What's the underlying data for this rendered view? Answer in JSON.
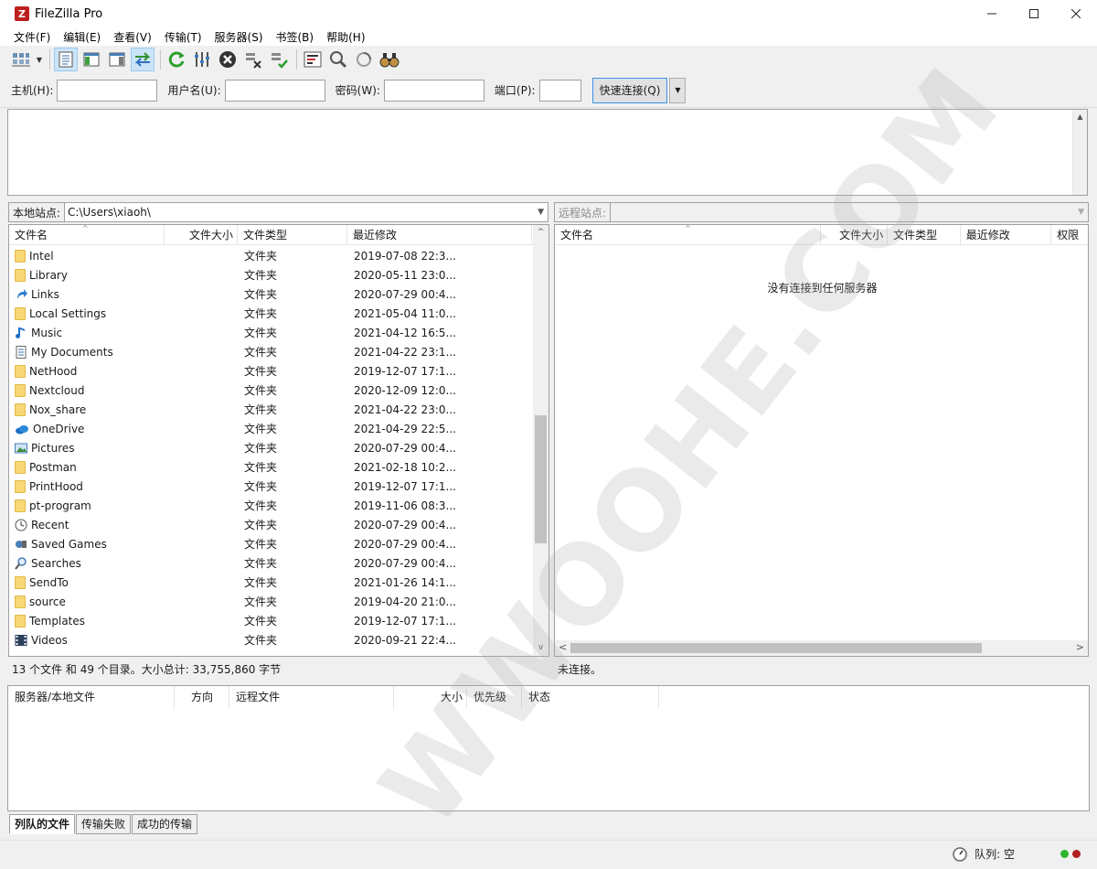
{
  "window": {
    "title": "FileZilla Pro",
    "app_icon": "Z"
  },
  "menu": [
    "文件(F)",
    "编辑(E)",
    "查看(V)",
    "传输(T)",
    "服务器(S)",
    "书签(B)",
    "帮助(H)"
  ],
  "quickconnect": {
    "host_label": "主机(H):",
    "host_value": "",
    "user_label": "用户名(U):",
    "user_value": "",
    "pass_label": "密码(W):",
    "pass_value": "",
    "port_label": "端口(P):",
    "port_value": "",
    "connect_label": "快速连接(Q)"
  },
  "local": {
    "site_label": "本地站点:",
    "path": "C:\\Users\\xiaoh\\",
    "columns": [
      "文件名",
      "文件大小",
      "文件类型",
      "最近修改"
    ],
    "rows": [
      {
        "name": "Intel",
        "type": "文件夹",
        "modified": "2019-07-08 22:3...",
        "icon": "folder"
      },
      {
        "name": "Library",
        "type": "文件夹",
        "modified": "2020-05-11 23:0...",
        "icon": "folder"
      },
      {
        "name": "Links",
        "type": "文件夹",
        "modified": "2020-07-29 00:4...",
        "icon": "link"
      },
      {
        "name": "Local Settings",
        "type": "文件夹",
        "modified": "2021-05-04 11:0...",
        "icon": "folder"
      },
      {
        "name": "Music",
        "type": "文件夹",
        "modified": "2021-04-12 16:5...",
        "icon": "music"
      },
      {
        "name": "My Documents",
        "type": "文件夹",
        "modified": "2021-04-22 23:1...",
        "icon": "document"
      },
      {
        "name": "NetHood",
        "type": "文件夹",
        "modified": "2019-12-07 17:1...",
        "icon": "folder"
      },
      {
        "name": "Nextcloud",
        "type": "文件夹",
        "modified": "2020-12-09 12:0...",
        "icon": "folder"
      },
      {
        "name": "Nox_share",
        "type": "文件夹",
        "modified": "2021-04-22 23:0...",
        "icon": "folder"
      },
      {
        "name": "OneDrive",
        "type": "文件夹",
        "modified": "2021-04-29 22:5...",
        "icon": "cloud"
      },
      {
        "name": "Pictures",
        "type": "文件夹",
        "modified": "2020-07-29 00:4...",
        "icon": "picture"
      },
      {
        "name": "Postman",
        "type": "文件夹",
        "modified": "2021-02-18 10:2...",
        "icon": "folder"
      },
      {
        "name": "PrintHood",
        "type": "文件夹",
        "modified": "2019-12-07 17:1...",
        "icon": "folder"
      },
      {
        "name": "pt-program",
        "type": "文件夹",
        "modified": "2019-11-06 08:3...",
        "icon": "folder"
      },
      {
        "name": "Recent",
        "type": "文件夹",
        "modified": "2020-07-29 00:4...",
        "icon": "recent"
      },
      {
        "name": "Saved Games",
        "type": "文件夹",
        "modified": "2020-07-29 00:4...",
        "icon": "games"
      },
      {
        "name": "Searches",
        "type": "文件夹",
        "modified": "2020-07-29 00:4...",
        "icon": "search"
      },
      {
        "name": "SendTo",
        "type": "文件夹",
        "modified": "2021-01-26 14:1...",
        "icon": "folder"
      },
      {
        "name": "source",
        "type": "文件夹",
        "modified": "2019-04-20 21:0...",
        "icon": "folder"
      },
      {
        "name": "Templates",
        "type": "文件夹",
        "modified": "2019-12-07 17:1...",
        "icon": "folder"
      },
      {
        "name": "Videos",
        "type": "文件夹",
        "modified": "2020-09-21 22:4...",
        "icon": "video"
      }
    ],
    "status": "13 个文件 和 49 个目录。大小总计: 33,755,860 字节"
  },
  "remote": {
    "site_label": "远程站点:",
    "path": "",
    "columns": [
      "文件名",
      "文件大小",
      "文件类型",
      "最近修改",
      "权限"
    ],
    "empty_message": "没有连接到任何服务器",
    "status": "未连接。"
  },
  "queue": {
    "columns": [
      "服务器/本地文件",
      "方向",
      "远程文件",
      "大小",
      "优先级",
      "状态"
    ]
  },
  "tabs": [
    "列队的文件",
    "传输失败",
    "成功的传输"
  ],
  "statusbar": {
    "queue_text": "队列: 空"
  },
  "watermark": "WWOOHE.COM",
  "colors": {
    "folder": "#f8d775",
    "accent": "#4a90d9",
    "led_green": "#2db52d",
    "led_red": "#b02020"
  }
}
